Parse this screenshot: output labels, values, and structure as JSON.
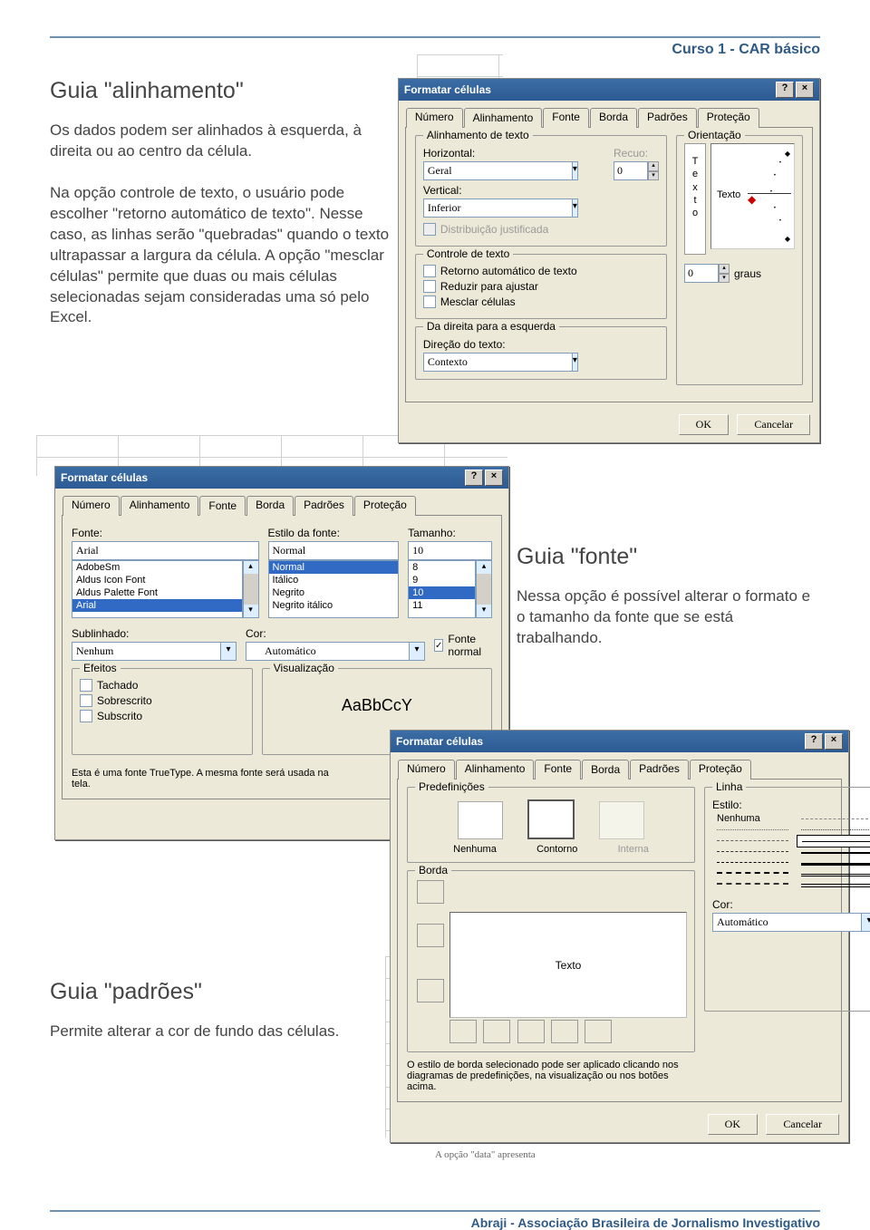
{
  "header": "Curso 1 -  CAR básico",
  "footer": "Abraji - Associação Brasileira de Jornalismo Investigativo",
  "section1": {
    "title": "Guia \"alinhamento\"",
    "para": "Os dados podem ser alinhados à esquerda, à direita ou ao centro da célula.\n\nNa opção controle de texto, o usuário pode escolher \"retorno automático de texto\". Nesse caso, as linhas serão \"quebradas\" quando o texto ultrapassar a largura da célula. A opção \"mesclar células\" permite que duas ou mais células selecionadas sejam consideradas uma só pelo Excel."
  },
  "section2": {
    "title": "Guia \"fonte\"",
    "para": "Nessa opção é possível alterar o formato e o tamanho da fonte que se está trabalhando."
  },
  "section3": {
    "title": "Guia \"padrões\"",
    "para": "Permite alterar a cor de fundo das células."
  },
  "dlg_common": {
    "title": "Formatar células",
    "tabs": {
      "numero": "Número",
      "alinhamento": "Alinhamento",
      "fonte": "Fonte",
      "borda": "Borda",
      "padroes": "Padrões",
      "protecao": "Proteção"
    },
    "ok": "OK",
    "cancel": "Cancelar"
  },
  "dlg1": {
    "grp_align": "Alinhamento de texto",
    "horizontal_lbl": "Horizontal:",
    "horizontal_val": "Geral",
    "vertical_lbl": "Vertical:",
    "vertical_val": "Inferior",
    "recuo_lbl": "Recuo:",
    "recuo_val": "0",
    "distrib": "Distribuição justificada",
    "grp_ctrl": "Controle de texto",
    "chk1": "Retorno automático de texto",
    "chk2": "Reduzir para ajustar",
    "chk3": "Mesclar células",
    "grp_rtl": "Da direita para a esquerda",
    "dir_lbl": "Direção do texto:",
    "dir_val": "Contexto",
    "grp_orient": "Orientação",
    "vert_text": "T\ne\nx\nt\no",
    "texto": "Texto",
    "graus_val": "0",
    "graus_lbl": "graus"
  },
  "dlg2": {
    "fonte_lbl": "Fonte:",
    "fonte_val": "Arial",
    "fonte_items": [
      "AdobeSm",
      "Aldus Icon Font",
      "Aldus Palette Font",
      "Arial"
    ],
    "estilo_lbl": "Estilo da fonte:",
    "estilo_val": "Normal",
    "estilo_items": [
      "Normal",
      "Itálico",
      "Negrito",
      "Negrito itálico"
    ],
    "tam_lbl": "Tamanho:",
    "tam_val": "10",
    "tam_items": [
      "8",
      "9",
      "10",
      "11"
    ],
    "sub_lbl": "Sublinhado:",
    "sub_val": "Nenhum",
    "cor_lbl": "Cor:",
    "cor_val": "Automático",
    "fontenormal": "Fonte normal",
    "grp_ef": "Efeitos",
    "ef1": "Tachado",
    "ef2": "Sobrescrito",
    "ef3": "Subscrito",
    "grp_vis": "Visualização",
    "sample": "AaBbCcY",
    "note": "Esta é uma fonte TrueType. A mesma fonte será usada na\ntela."
  },
  "dlg3": {
    "grp_preset": "Predefinições",
    "p1": "Nenhuma",
    "p2": "Contorno",
    "p3": "Interna",
    "grp_borda": "Borda",
    "preview_text": "Texto",
    "grp_linha": "Linha",
    "estilo_lbl": "Estilo:",
    "nenhuma": "Nenhuma",
    "cor_lbl": "Cor:",
    "cor_val": "Automático",
    "note": "O estilo de borda selecionado pode ser aplicado clicando nos diagramas de predefinições, na visualização ou nos botões acima."
  },
  "bottom_fragment": "A opção \"data\" apresenta"
}
